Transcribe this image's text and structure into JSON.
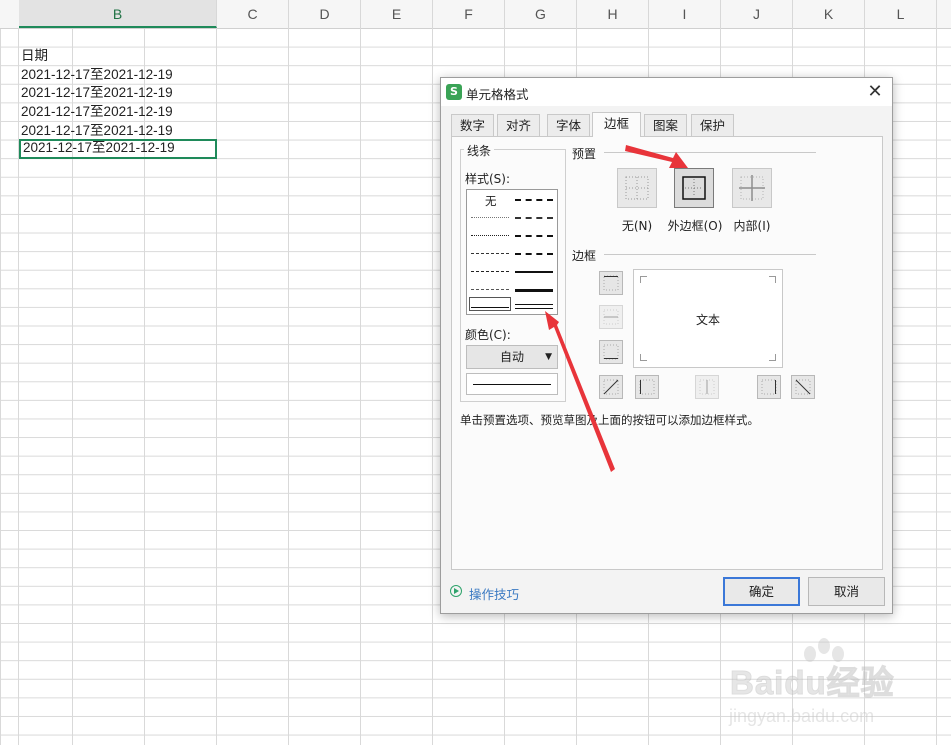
{
  "sheet": {
    "columns": [
      "B",
      "C",
      "D",
      "E",
      "F",
      "G",
      "H",
      "I",
      "J",
      "K",
      "L"
    ],
    "active_column": "B",
    "cells": [
      {
        "text": "日期"
      },
      {
        "text": "2021-12-17至2021-12-19"
      },
      {
        "text": "2021-12-17至2021-12-19"
      },
      {
        "text": "2021-12-17至2021-12-19"
      },
      {
        "text": "2021-12-17至2021-12-19"
      },
      {
        "text": "2021-12-17至2021-12-19"
      }
    ],
    "selection_color": "#1f8a5a"
  },
  "dialog": {
    "app_icon": "S",
    "title": "单元格格式",
    "close_icon": "✕",
    "tabs": [
      {
        "label": "数字"
      },
      {
        "label": "对齐"
      },
      {
        "label": "字体"
      },
      {
        "label": "边框",
        "active": true
      },
      {
        "label": "图案"
      },
      {
        "label": "保护"
      }
    ],
    "line_group": {
      "title": "线条",
      "style_label": "样式(S):",
      "none_label": "无",
      "color_label": "颜色(C):",
      "color_value": "自动"
    },
    "presets": {
      "title": "预置",
      "items": [
        {
          "label": "无(N)",
          "icon": "border-none-icon"
        },
        {
          "label": "外边框(O)",
          "icon": "border-outline-icon"
        },
        {
          "label": "内部(I)",
          "icon": "border-inside-icon"
        }
      ]
    },
    "border": {
      "title": "边框",
      "preview_text": "文本"
    },
    "hint": "单击预置选项、预览草图及上面的按钮可以添加边框样式。",
    "tips_label": "操作技巧",
    "ok_label": "确定",
    "cancel_label": "取消",
    "accent_color": "#3b78d8",
    "annotation_color": "#e8343a"
  },
  "watermark": {
    "brand": "Baidu经验",
    "url": "jingyan.baidu.com"
  }
}
